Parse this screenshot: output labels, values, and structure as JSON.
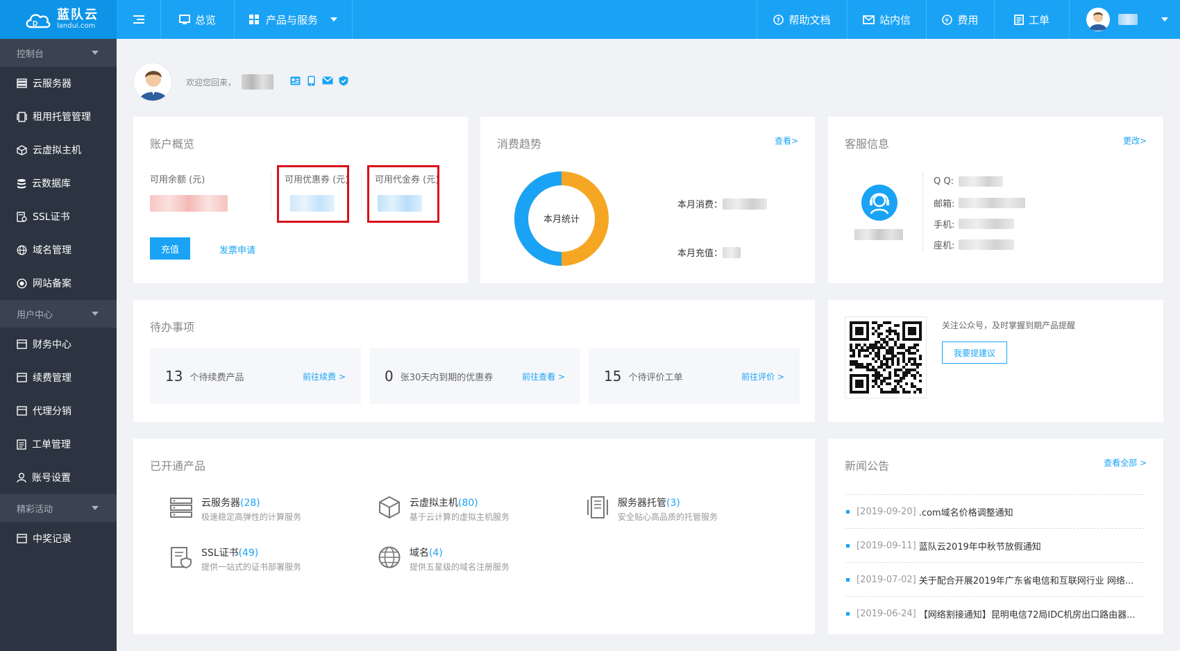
{
  "brand": {
    "name": "蓝队云",
    "domain": "landui.com"
  },
  "topnav": {
    "overview": "总览",
    "products": "产品与服务",
    "help": "帮助文档",
    "messages": "站内信",
    "fees": "费用",
    "tickets": "工单"
  },
  "sidebar": {
    "groups": [
      "控制台",
      "用户中心",
      "精彩活动"
    ],
    "items": [
      "云服务器",
      "租用托管管理",
      "云虚拟主机",
      "云数据库",
      "SSL证书",
      "域名管理",
      "网站备案",
      "财务中心",
      "续费管理",
      "代理分销",
      "工单管理",
      "账号设置",
      "中奖记录"
    ]
  },
  "welcome": {
    "text": "欢迎您回来，"
  },
  "account": {
    "title": "账户概览",
    "balance_label": "可用余额 (元)",
    "coupon_label": "可用优惠券 (元)",
    "voucher_label": "可用代金券 (元)",
    "recharge": "充值",
    "invoice": "发票申请"
  },
  "trend": {
    "title": "消费趋势",
    "view": "查看>",
    "donut_label": "本月统计",
    "month_spend": "本月消费：",
    "month_recharge": "本月充值："
  },
  "service": {
    "title": "客服信息",
    "change": "更改>",
    "qq": "Q Q:",
    "email": "邮箱:",
    "phone": "手机:",
    "landline": "座机:"
  },
  "todo": {
    "title": "待办事项",
    "items": [
      {
        "count": "13",
        "text": "个待续费产品",
        "link": "前往续费 >"
      },
      {
        "count": "0",
        "text": "张30天内到期的优惠券",
        "link": "前往查看 >"
      },
      {
        "count": "15",
        "text": "个待评价工单",
        "link": "前往评价 >"
      }
    ]
  },
  "wechat": {
    "text": "关注公众号，及时掌握到期产品提醒",
    "button": "我要提建议"
  },
  "products": {
    "title": "已开通产品",
    "items": [
      {
        "name": "云服务器",
        "count": "(28)",
        "desc": "极速稳定高弹性的计算服务"
      },
      {
        "name": "云虚拟主机",
        "count": "(80)",
        "desc": "基于云计算的虚拟主机服务"
      },
      {
        "name": "服务器托管",
        "count": "(3)",
        "desc": "安全贴心高品质的托管服务"
      },
      {
        "name": "SSL证书",
        "count": "(49)",
        "desc": "提供一站式的证书部署服务"
      },
      {
        "name": "域名",
        "count": "(4)",
        "desc": "提供五星级的域名注册服务"
      }
    ]
  },
  "news": {
    "title": "新闻公告",
    "all": "查看全部 >",
    "items": [
      {
        "date": "[2019-09-20]",
        "title": ".com域名价格调整通知"
      },
      {
        "date": "[2019-09-11]",
        "title": "蓝队云2019年中秋节放假通知"
      },
      {
        "date": "[2019-07-02]",
        "title": "关于配合开展2019年广东省电信和互联网行业 网络..."
      },
      {
        "date": "[2019-06-24]",
        "title": "【网络割接通知】昆明电信72局IDC机房出口路由器..."
      }
    ]
  },
  "colors": {
    "primary": "#1aa3f5",
    "sidebar": "#2b3440",
    "donut_blue": "#1aa3f5",
    "donut_orange": "#f5a623",
    "highlight": "#d8111a"
  }
}
